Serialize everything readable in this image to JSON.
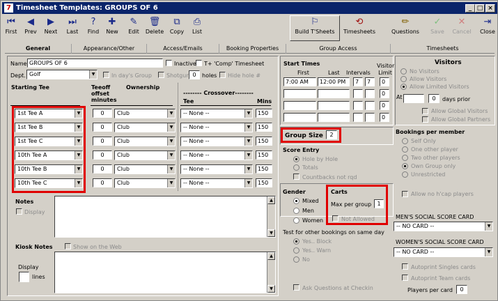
{
  "window": {
    "title": "Timesheet Templates: GROUPS OF 6",
    "icon_glyph": "7",
    "min": "_",
    "max": "□",
    "close": "×"
  },
  "toolbar": {
    "first": "First",
    "prev": "Prev",
    "next": "Next",
    "last": "Last",
    "find": "Find",
    "new": "New",
    "edit": "Edit",
    "delete": "Delete",
    "copy": "Copy",
    "list": "List",
    "build": "Build T'Sheets",
    "timesheets": "Timesheets",
    "questions": "Questions",
    "save": "Save",
    "cancel": "Cancel",
    "close": "Close"
  },
  "tabs": [
    "General",
    "Appearance/Other",
    "Access/Emails",
    "Booking Properties",
    "Group Access",
    "Timesheets"
  ],
  "general": {
    "name_label": "Name",
    "name_value": "GROUPS OF 6",
    "inactive_label": "Inactive",
    "tcomp_label": "T+ 'Comp' Timesheet",
    "dept_label": "Dept.",
    "dept_value": "Golf",
    "indays_label": "In day's Group",
    "shotgun_label": "Shotgun",
    "holes_value": "0",
    "holes_label": "holes",
    "hidehole_label": "Hide hole #",
    "starting_tee_header": "Starting Tee",
    "teeoff_header": "Teeoff offset minutes",
    "ownership_header": "Ownership",
    "crossover_header": "-------- Crossover--------",
    "tee_header": "Tee",
    "mins_header": "Mins",
    "rows": [
      {
        "tee": "1st Tee A",
        "offset": "0",
        "ownership": "Club",
        "cross": "-- None --",
        "mins": "150"
      },
      {
        "tee": "1st Tee B",
        "offset": "0",
        "ownership": "Club",
        "cross": "-- None --",
        "mins": "150"
      },
      {
        "tee": "1st Tee C",
        "offset": "0",
        "ownership": "Club",
        "cross": "-- None --",
        "mins": "150"
      },
      {
        "tee": "10th Tee A",
        "offset": "0",
        "ownership": "Club",
        "cross": "-- None --",
        "mins": "150"
      },
      {
        "tee": "10th Tee B",
        "offset": "0",
        "ownership": "Club",
        "cross": "-- None --",
        "mins": "150"
      },
      {
        "tee": "10th Tee C",
        "offset": "0",
        "ownership": "Club",
        "cross": "-- None --",
        "mins": "150"
      }
    ],
    "notes_label": "Notes",
    "display_label": "Display",
    "kiosk_label": "Kiosk Notes",
    "show_web_label": "Show on the Web",
    "display2_label": "Display",
    "lines_label": "lines",
    "start_times_label": "Start Times",
    "first_label": "First",
    "last_label": "Last",
    "intervals_label": "Intervals",
    "visitor_limit_label": "Visitor Limit",
    "start_first": "7:00 AM",
    "start_last": "12:00 PM",
    "interval1": "7",
    "interval2": "7",
    "visitor_limits": [
      "0",
      "0",
      "0",
      "0"
    ],
    "visitors_label": "Visitors",
    "no_visitors": "No Visitors",
    "allow_visitors": "Allow Visitors",
    "allow_limited": "Allow Limited Visitors",
    "at_label": "At",
    "days_value": "0",
    "days_prior": "days prior",
    "allow_global_visitors": "Allow Global Visitors",
    "allow_global_partners": "Allow Global Partners",
    "group_size_label": "Group Size",
    "group_size_value": "2",
    "bookings_label": "Bookings per member",
    "self_only": "Self Only",
    "one_other": "One other player",
    "two_other": "Two other players",
    "own_group": "Own Group only",
    "unrestricted": "Unrestricted",
    "score_entry_label": "Score Entry",
    "hole_by_hole": "Hole by Hole",
    "totals": "Totals",
    "countbacks": "Countbacks not rqd",
    "gender_label": "Gender",
    "mixed": "Mixed",
    "men": "Men",
    "women": "Women",
    "carts_label": "Carts",
    "max_per_group_label": "Max per group",
    "max_per_group_value": "1",
    "not_allowed": "Not Allowed",
    "allow_nohcap": "Allow no h'cap players",
    "test_label": "Test for other bookings on  same day",
    "yes_block": "Yes.. Block",
    "yes_warn": "Yes.. Warn",
    "no": "No",
    "ask_questions": "Ask Questions at Checkin",
    "mens_card_label": "MEN'S SOCIAL SCORE CARD",
    "mens_card_value": "-- NO CARD --",
    "womens_card_label": "WOMEN'S SOCIAL SCORE CARD",
    "womens_card_value": "-- NO CARD --",
    "autoprint_singles": "Autoprint Singles cards",
    "autoprint_team": "Autoprint Team cards",
    "players_per_card_label": "Players per card",
    "players_per_card_value": "0"
  },
  "colors": {
    "titlebar": "#0a246a",
    "highlight": "#e00000",
    "face": "#d4d0c8"
  }
}
